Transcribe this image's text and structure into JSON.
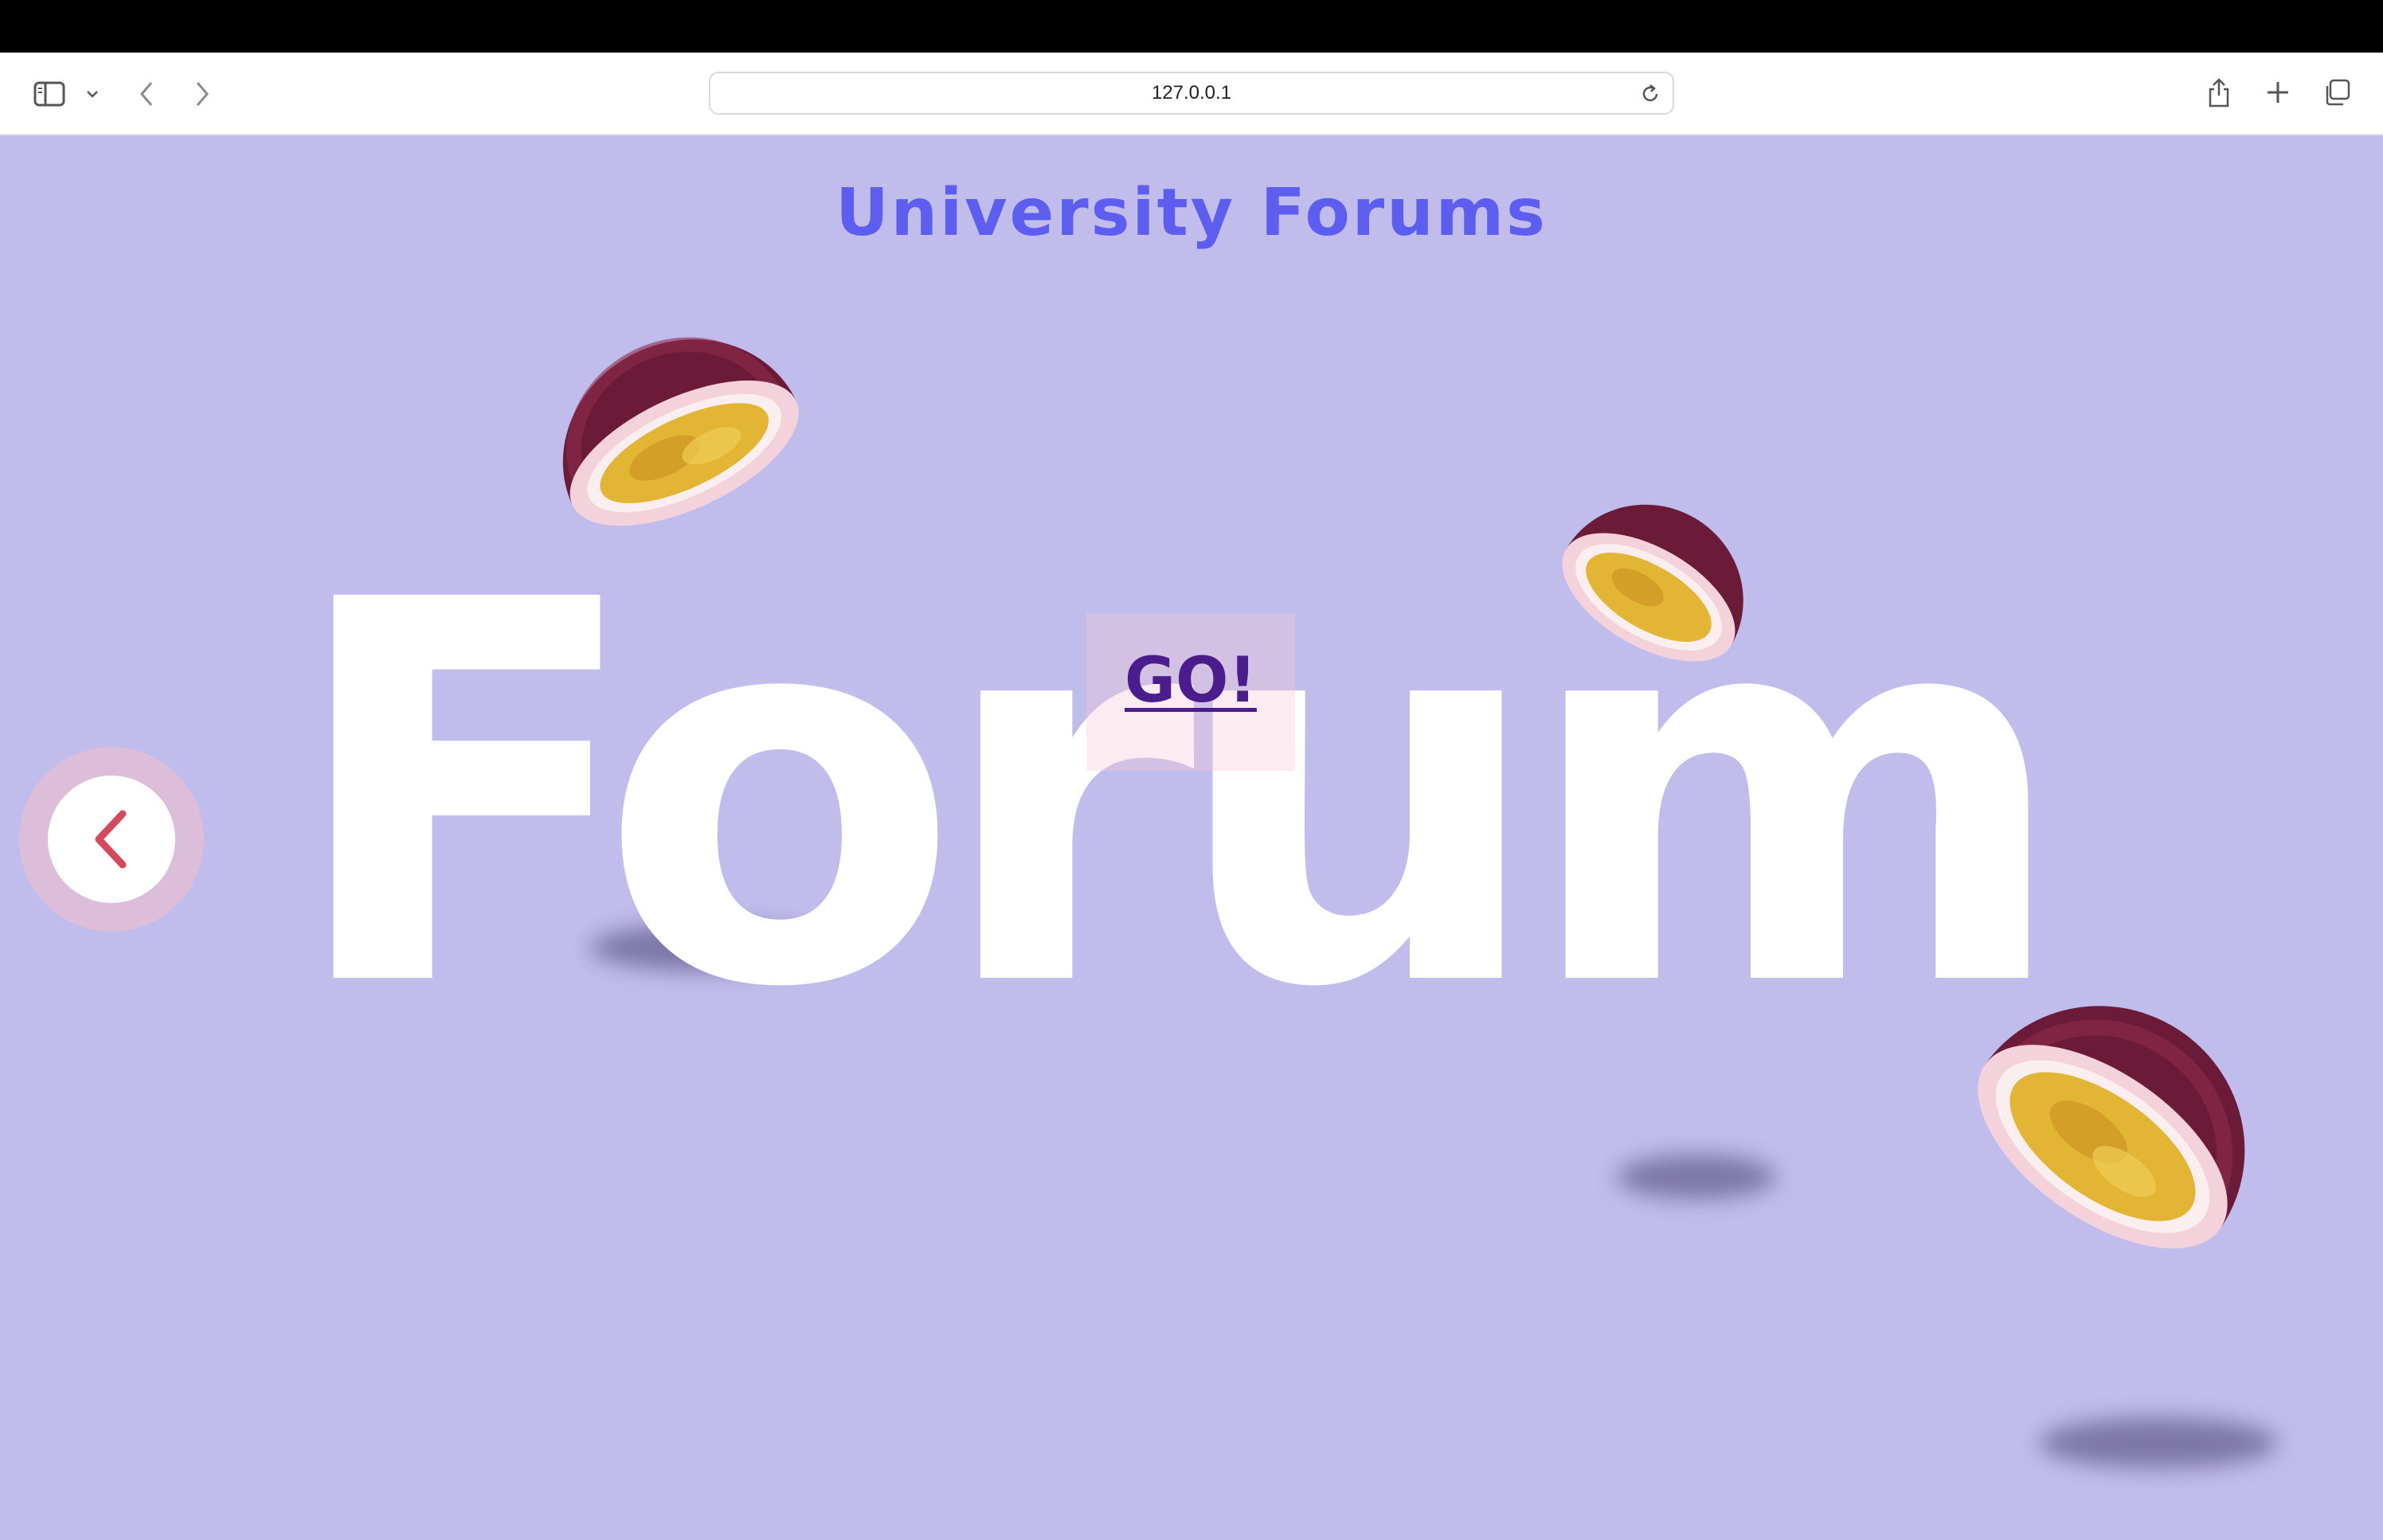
{
  "browser": {
    "url": "127.0.0.1"
  },
  "page": {
    "title": "University Forums",
    "hero_word": "Forum",
    "go_label": "GO!",
    "colors": {
      "background": "#c0bdec",
      "title": "#5d5ef0",
      "go_link": "#4b1c8c",
      "back_arrow": "#d24a5c"
    }
  },
  "icons": {
    "sidebar": "sidebar-icon",
    "chevron": "chevron-down-icon",
    "back": "back-arrow-icon",
    "forward": "forward-arrow-icon",
    "reload": "reload-icon",
    "share": "share-icon",
    "new_tab": "plus-icon",
    "tabs": "tabs-overview-icon",
    "page_back": "chevron-left-icon",
    "fruit": "passion-fruit-image"
  }
}
